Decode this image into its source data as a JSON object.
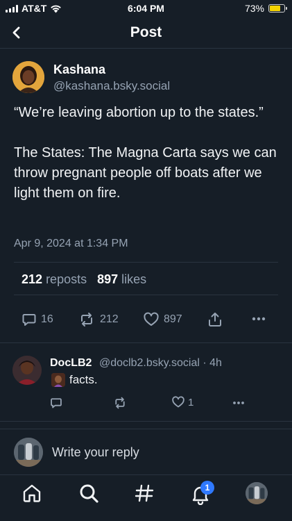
{
  "status_bar": {
    "carrier": "AT&T",
    "time": "6:04 PM",
    "battery": "73%",
    "battery_level": 0.73
  },
  "header": {
    "title": "Post"
  },
  "post": {
    "display_name": "Kashana",
    "handle": "@kashana.bsky.social",
    "text": "“We’re leaving abortion up to the states.”\n\nThe States: The Magna Carta says we can throw pregnant people off boats after we light them on fire.",
    "timestamp": "Apr 9, 2024 at 1:34 PM",
    "stats": {
      "reposts_count": "212",
      "reposts_label": "reposts",
      "likes_count": "897",
      "likes_label": "likes"
    },
    "actions": {
      "replies": "16",
      "reposts": "212",
      "likes": "897"
    }
  },
  "reply": {
    "display_name": "DocLB2",
    "handle_time": "@doclb2.bsky.social · 4h",
    "text": "facts.",
    "likes": "1"
  },
  "composer": {
    "placeholder": "Write your reply"
  },
  "tabbar": {
    "notifications_badge": "1"
  },
  "colors": {
    "background": "#161e27",
    "divider": "#2a3440",
    "muted": "#96a3b3",
    "accent": "#2f79ff"
  }
}
